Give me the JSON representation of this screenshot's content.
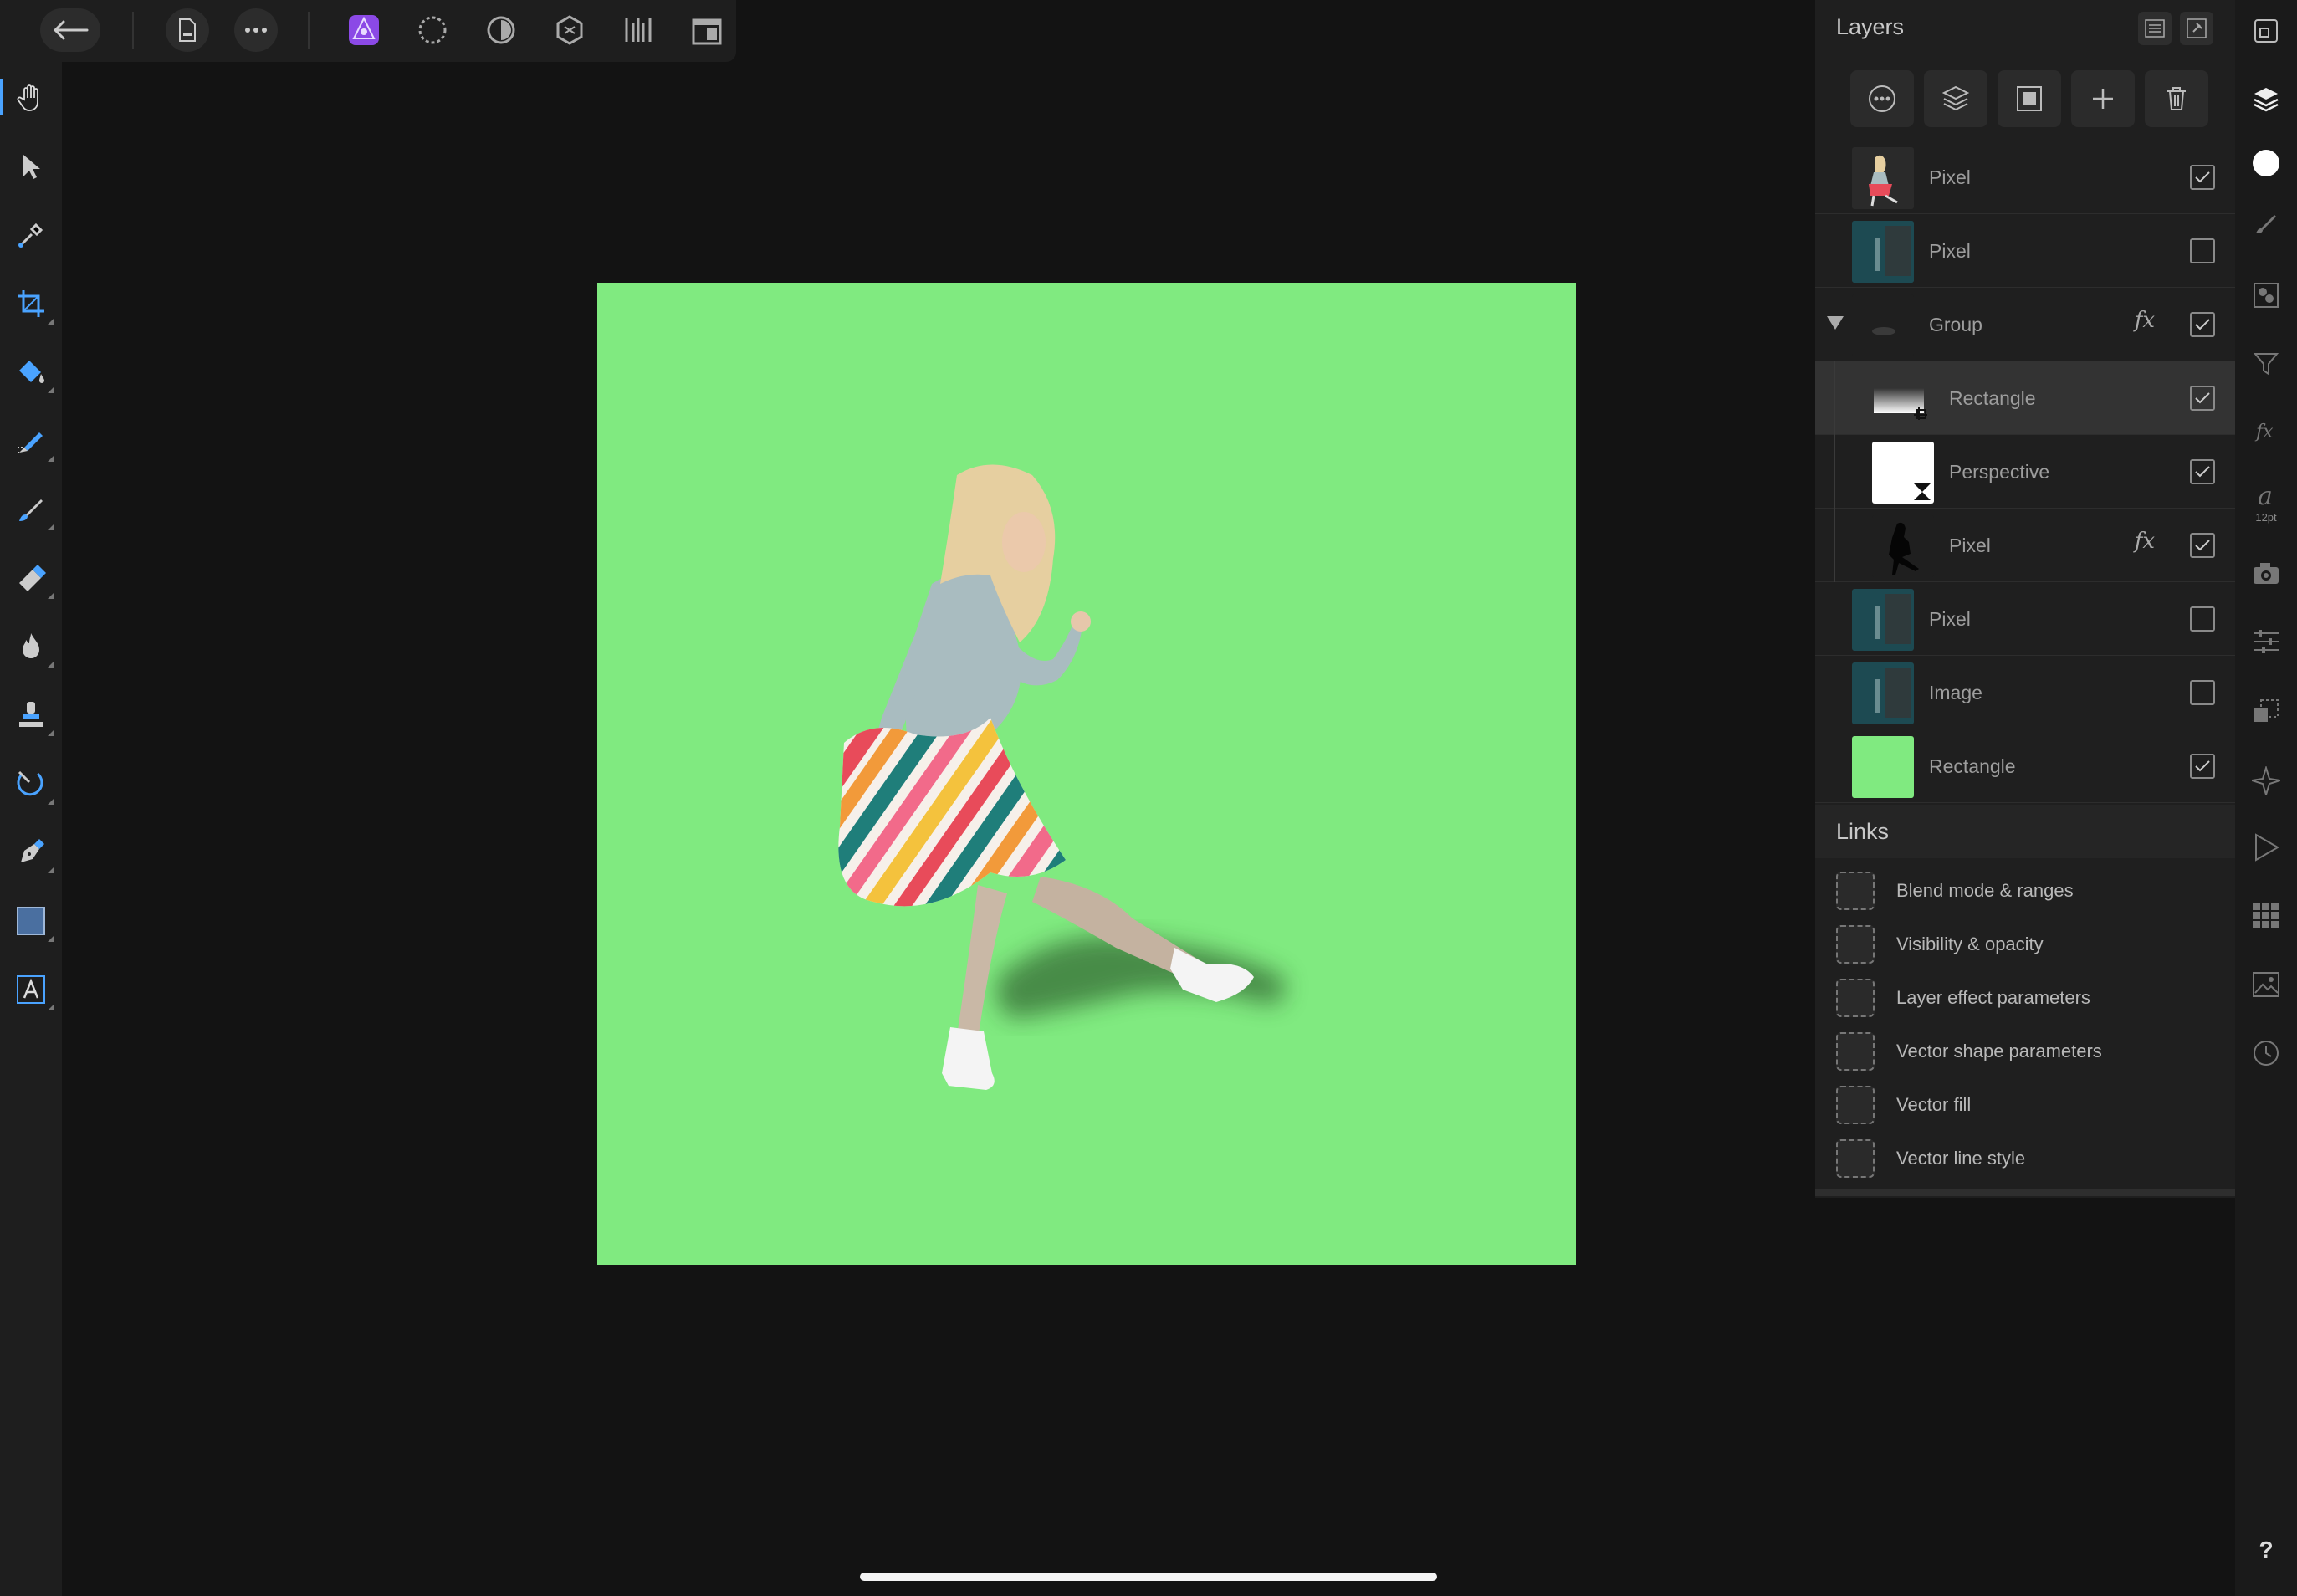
{
  "top_toolbar": {
    "buttons": [
      "back-arrow-icon",
      "document-icon",
      "more-icon",
      "photo-persona-icon",
      "liquify-persona-icon",
      "develop-persona-icon",
      "tone-mapping-persona-icon",
      "export-persona-icon",
      "view-options-icon"
    ],
    "accent": "#8b49e6"
  },
  "left_tools": [
    "hand",
    "move",
    "color-picker",
    "crop",
    "flood-fill",
    "selection-brush",
    "paint-brush",
    "erase-brush",
    "dodge-burn",
    "clone-brush",
    "healing",
    "pen",
    "rectangle",
    "text"
  ],
  "canvas": {
    "background_color": "#80ea80"
  },
  "layers_panel": {
    "title": "Layers",
    "layers": [
      {
        "name": "Pixel",
        "checked": true,
        "fx": false,
        "thumb": "woman"
      },
      {
        "name": "Pixel",
        "checked": false,
        "fx": false,
        "thumb": "dark-scene"
      },
      {
        "name": "Group",
        "checked": true,
        "fx": true,
        "thumb": "shadow",
        "expanded": true
      },
      {
        "name": "Rectangle",
        "checked": true,
        "fx": false,
        "thumb": "gradient",
        "selected": true
      },
      {
        "name": "Perspective",
        "checked": true,
        "fx": false,
        "thumb": "white"
      },
      {
        "name": "Pixel",
        "checked": true,
        "fx": true,
        "thumb": "silhouette"
      },
      {
        "name": "Pixel",
        "checked": false,
        "fx": false,
        "thumb": "dark-scene"
      },
      {
        "name": "Image",
        "checked": false,
        "fx": false,
        "thumb": "dark-scene"
      },
      {
        "name": "Rectangle",
        "checked": true,
        "fx": false,
        "thumb": "green"
      }
    ]
  },
  "links_panel": {
    "title": "Links",
    "items": [
      "Blend mode & ranges",
      "Visibility & opacity",
      "Layer effect parameters",
      "Vector shape parameters",
      "Vector fill",
      "Vector line style"
    ]
  },
  "right_studio": {
    "text_size_label": "12pt",
    "help_label": "?"
  }
}
